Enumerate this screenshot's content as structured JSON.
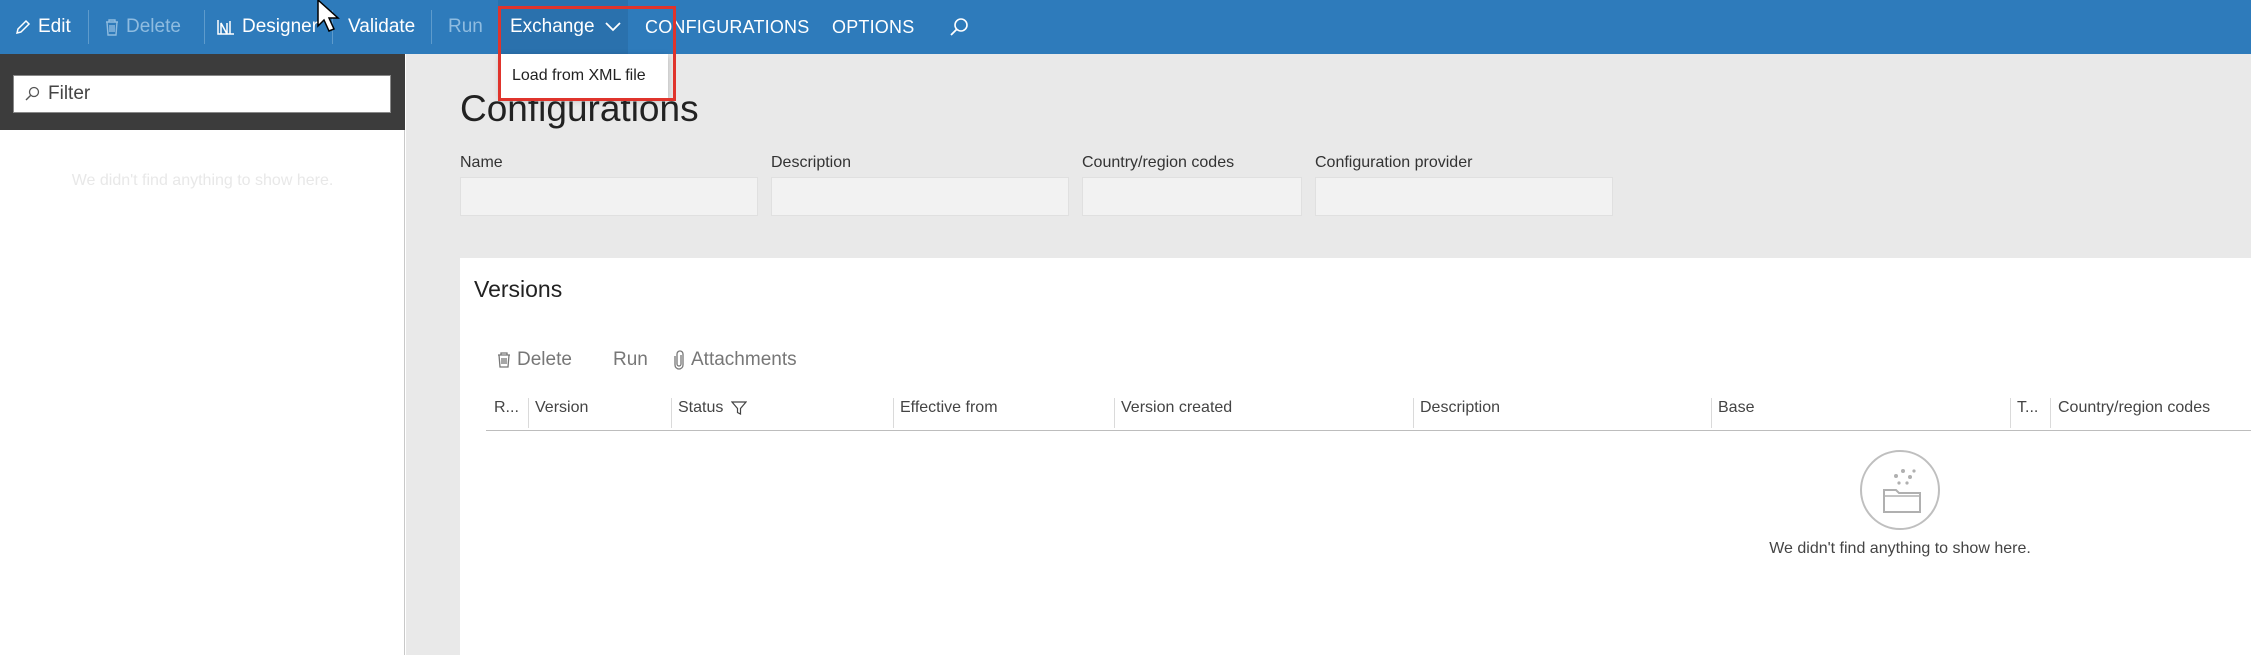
{
  "toolbar": {
    "edit": "Edit",
    "delete": "Delete",
    "designer": "Designer",
    "validate": "Validate",
    "run": "Run",
    "exchange": "Exchange",
    "configurations": "CONFIGURATIONS",
    "options": "OPTIONS",
    "search_icon": "search-icon"
  },
  "exchange_menu": {
    "items": [
      {
        "label": "Load from XML file"
      }
    ]
  },
  "left_pane": {
    "filter_placeholder": "Filter",
    "empty_text": "We didn't find anything to show here."
  },
  "page": {
    "title": "Configurations",
    "fields": [
      {
        "label": "Name",
        "value": ""
      },
      {
        "label": "Description",
        "value": ""
      },
      {
        "label": "Country/region codes",
        "value": ""
      },
      {
        "label": "Configuration provider",
        "value": ""
      }
    ]
  },
  "versions": {
    "title": "Versions",
    "actions": {
      "delete": "Delete",
      "run": "Run",
      "attachments": "Attachments"
    },
    "columns": [
      "R...",
      "Version",
      "Status",
      "Effective from",
      "Version created",
      "Description",
      "Base",
      "T...",
      "Country/region codes"
    ],
    "empty_text": "We didn't find anything to show here."
  },
  "colors": {
    "toolbar_bg": "#2e7bbb",
    "highlight_border": "#e0342c",
    "main_bg": "#e9e9e9"
  }
}
